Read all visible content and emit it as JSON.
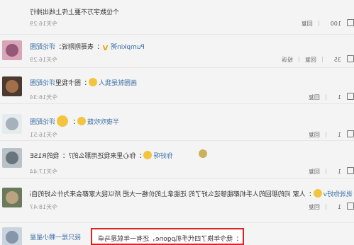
{
  "top_comment": {
    "text": "个位数字万不要上传上线出排行",
    "time": "今天16:29",
    "reply_label": "回复",
    "like_count": "100"
  },
  "comments": [
    {
      "user": "Pumpkin粥",
      "text": "：表哥刚刚说：",
      "link": "评论配图",
      "time": "今天16:29",
      "reply_label": "回复",
      "report_label": "投诉",
      "like_count": "35"
    },
    {
      "user": "画图就是我人",
      "text": "：图卡我里",
      "link": "评论配图",
      "time": "今天16:34",
      "reply_label": "回复",
      "like_count": "1"
    },
    {
      "user": "半夜吹吹鼓",
      "text": "：",
      "link": "评论配图",
      "time": "今天16:51",
      "reply_label": "回复",
      "like_count": "1"
    },
    {
      "user": "你好呀",
      "text": "：你心里来我还用那么的？：我的R1SE",
      "link": "",
      "time": "今天17:44",
      "reply_label": "回复",
      "like_count": "1"
    },
    {
      "user": "说说你好v",
      "text": "：人家 问的那回的人手机都能够这么好了的 还能拿上的价格一大把 所以我大家都会来为什么好的自己没",
      "link": "",
      "time": "今天18:47",
      "reply_label": "回复",
      "like_count": "1"
    }
  ],
  "highlighted": {
    "user": "我只是一颗小星星",
    "text": "：我今年换了四代手机pgone，还有一年就是马卓"
  }
}
